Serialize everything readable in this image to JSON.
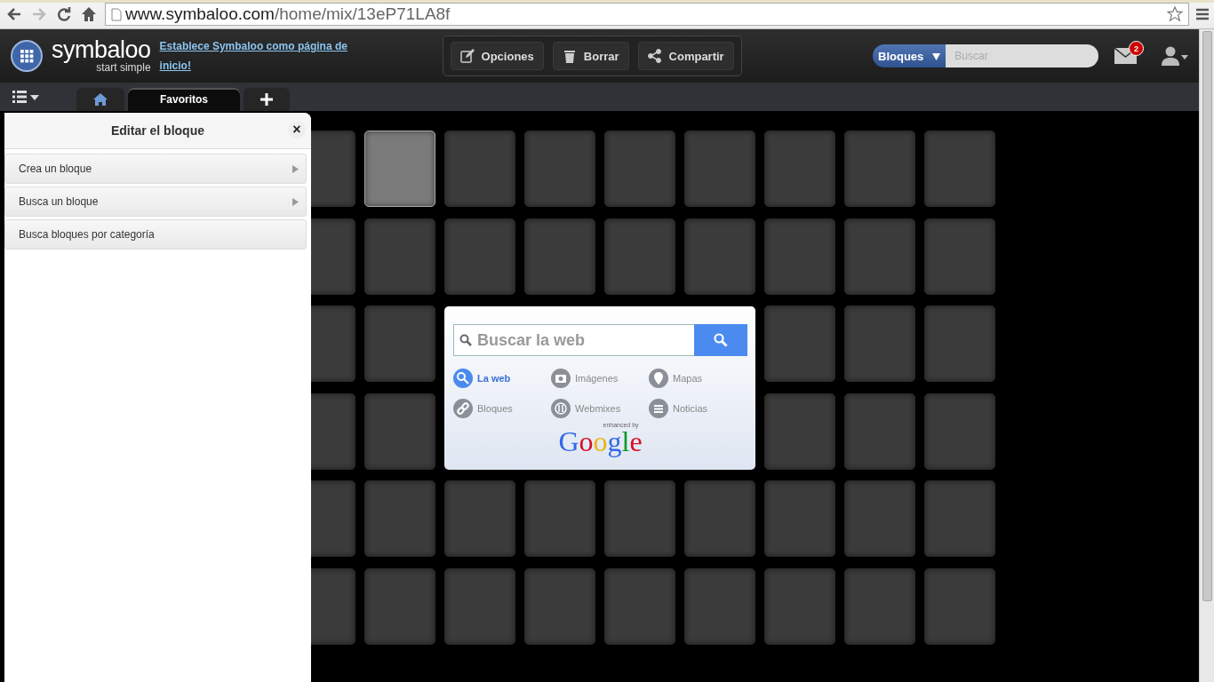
{
  "browser": {
    "url_host": "www.symbaloo.com",
    "url_path": "/home/mix/13eP71LA8f",
    "forward_disabled": true
  },
  "header": {
    "logo_name": "symbaloo",
    "logo_tagline": "start simple",
    "homepage_link": "Establece Symbaloo como página de inicio!",
    "actions": [
      {
        "kind": "edit",
        "label": "Opciones"
      },
      {
        "kind": "trash",
        "label": "Borrar"
      },
      {
        "kind": "share",
        "label": "Compartir"
      }
    ],
    "search": {
      "scope": "Bloques",
      "placeholder": "Buscar"
    },
    "mail_badge": "2"
  },
  "tabs": [
    {
      "kind": "home",
      "selected": false
    },
    {
      "kind": "text",
      "label": "Favoritos",
      "selected": true
    },
    {
      "kind": "add",
      "selected": false
    }
  ],
  "panel": {
    "title": "Editar el bloque",
    "close": "×",
    "items": [
      {
        "label": "Crea un bloque",
        "has_submenu": true
      },
      {
        "label": "Busca un bloque",
        "has_submenu": true
      },
      {
        "label": "Busca bloques por categoría",
        "has_submenu": false
      }
    ]
  },
  "search_widget": {
    "placeholder": "Buscar la web",
    "options": [
      {
        "kind": "web",
        "label": "La web",
        "selected": true
      },
      {
        "kind": "images",
        "label": "Imágenes",
        "selected": false
      },
      {
        "kind": "maps",
        "label": "Mapas",
        "selected": false
      },
      {
        "kind": "blocks",
        "label": "Bloques",
        "selected": false
      },
      {
        "kind": "webmixes",
        "label": "Webmixes",
        "selected": false
      },
      {
        "kind": "news",
        "label": "Noticias",
        "selected": false
      }
    ],
    "enhanced_by": "enhanced by",
    "brand": "Google"
  },
  "tiles": [
    {
      "selected": false
    },
    {
      "selected": true
    },
    {
      "selected": false
    },
    {
      "selected": false
    },
    {
      "selected": false
    },
    {
      "selected": false
    },
    {
      "selected": false
    },
    {
      "selected": false
    },
    {
      "selected": false
    },
    {
      "selected": false
    },
    {
      "selected": false
    },
    {
      "selected": false
    },
    {
      "selected": false
    },
    {
      "selected": false
    },
    {
      "selected": false
    },
    {
      "selected": false
    },
    {
      "selected": false
    },
    {
      "selected": false
    },
    {
      "selected": false
    },
    {
      "selected": false
    },
    {
      "selected": false
    },
    {
      "selected": false
    },
    {
      "selected": false
    },
    {
      "selected": false
    },
    {
      "selected": false
    },
    {
      "selected": false
    },
    {
      "selected": false
    },
    {
      "selected": false
    },
    {
      "selected": false
    },
    {
      "selected": false
    },
    {
      "selected": false
    },
    {
      "selected": false
    },
    {
      "selected": false
    },
    {
      "selected": false
    },
    {
      "selected": false
    },
    {
      "selected": false
    },
    {
      "selected": false
    },
    {
      "selected": false
    },
    {
      "selected": false
    },
    {
      "selected": false
    },
    {
      "selected": false
    },
    {
      "selected": false
    },
    {
      "selected": false
    },
    {
      "selected": false
    },
    {
      "selected": false
    },
    {
      "selected": false
    }
  ]
}
